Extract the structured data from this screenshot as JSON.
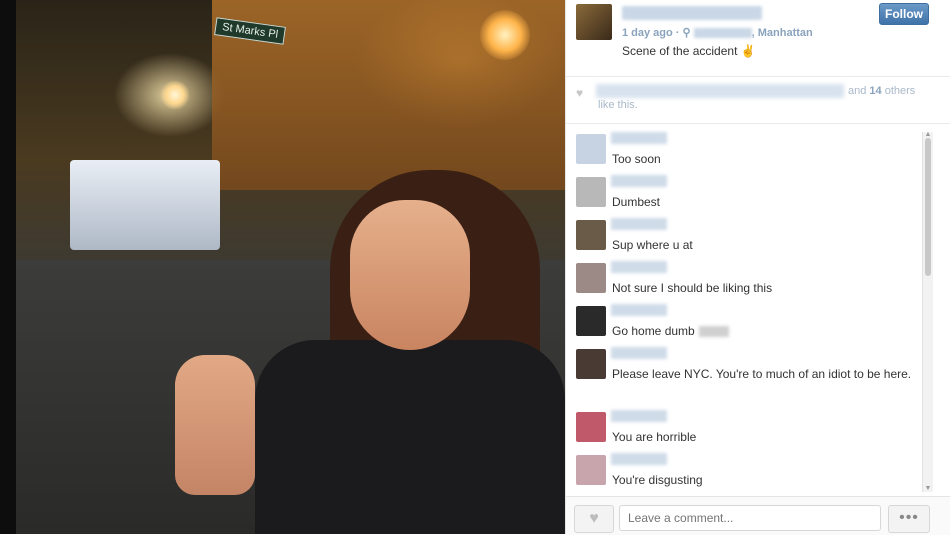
{
  "post": {
    "meta_time": "1 day ago",
    "meta_sep": " · ",
    "meta_location_suffix": ", Manhattan",
    "caption": "Scene of the accident ✌"
  },
  "photo": {
    "street_sign": "St Marks Pl"
  },
  "header": {
    "follow_label": "Follow"
  },
  "likes": {
    "heart_icon": "♥",
    "and_text": "and",
    "others_count": "14",
    "others_text": "others",
    "like_this": "like this."
  },
  "comments": [
    {
      "text": "Too soon",
      "avatar_color": "#c7d3e3"
    },
    {
      "text": "Dumbest",
      "avatar_color": "#b8b8b8"
    },
    {
      "text": "Sup where u at",
      "avatar_color": "#6a5a48"
    },
    {
      "text": "Not sure I should be liking this",
      "avatar_color": "#9c8a86"
    },
    {
      "text": "Go home dumb",
      "avatar_color": "#2a2a2a"
    },
    {
      "text": "Please leave NYC. You're to much of an idiot to be here.",
      "avatar_color": "#4a3a34"
    },
    {
      "text": "You are horrible",
      "avatar_color": "#c05a6a"
    },
    {
      "text": "You're disgusting",
      "avatar_color": "#c8a4ac"
    }
  ],
  "footer": {
    "like_icon": "♥",
    "comment_placeholder": "Leave a comment...",
    "more_icon": "•••"
  },
  "colors": {
    "follow_button": "#3f72a8",
    "link_blue": "#8aa3bd"
  }
}
